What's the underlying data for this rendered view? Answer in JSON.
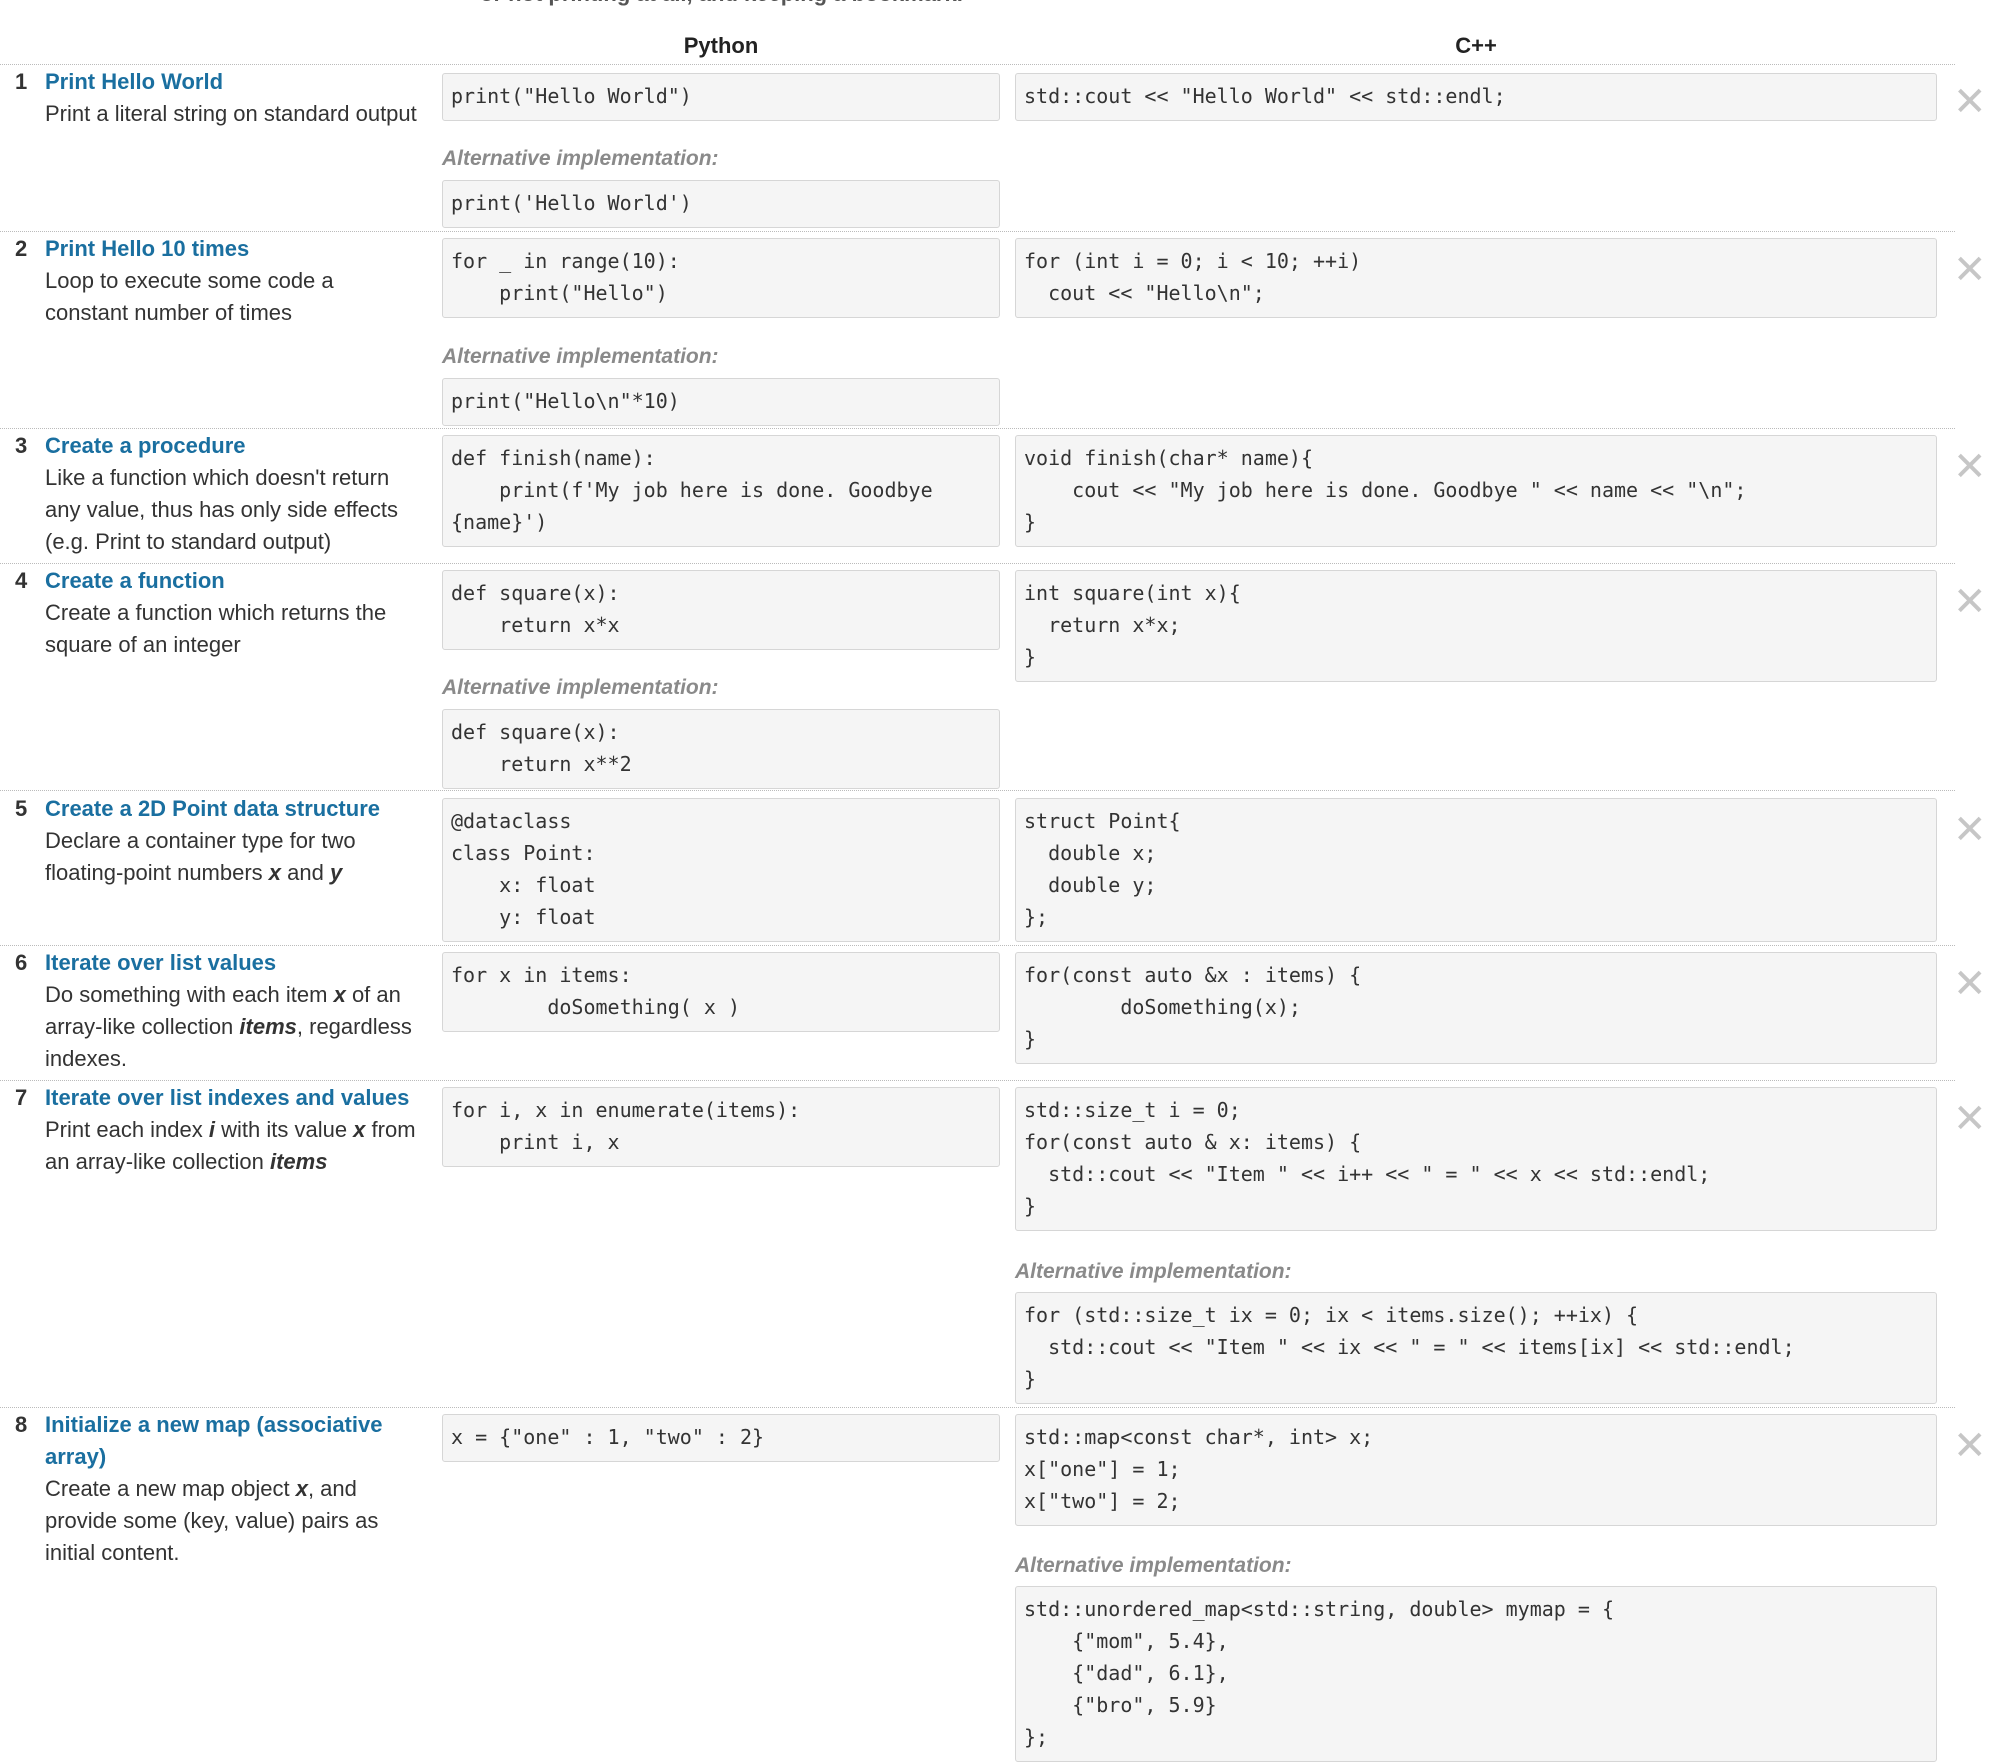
{
  "header": {
    "top_text": "or not printing at all, and keeping a bookmark."
  },
  "columns": {
    "python": "Python",
    "cpp": "C++"
  },
  "alt_label": "Alternative implementation:",
  "close_symbol": "✕",
  "rows": [
    {
      "num": "1",
      "title": "Print Hello World",
      "desc": "Print a literal string on standard output",
      "python": "print(\"Hello World\")",
      "python_alt": "print('Hello World')",
      "cpp": "std::cout << \"Hello World\" << std::endl;"
    },
    {
      "num": "2",
      "title": "Print Hello 10 times",
      "desc": "Loop to execute some code a constant number of times",
      "python": "for _ in range(10):\n    print(\"Hello\")",
      "python_alt": "print(\"Hello\\n\"*10)",
      "cpp": "for (int i = 0; i < 10; ++i)\n  cout << \"Hello\\n\";"
    },
    {
      "num": "3",
      "title": "Create a procedure",
      "desc": "Like a function which doesn't return any value, thus has only side effects (e.g. Print to standard output)",
      "python": "def finish(name):\n    print(f'My job here is done. Goodbye\n{name}')",
      "cpp": "void finish(char* name){\n    cout << \"My job here is done. Goodbye \" << name << \"\\n\";\n}"
    },
    {
      "num": "4",
      "title": "Create a function",
      "desc": "Create a function which returns the square of an integer",
      "python": "def square(x):\n    return x*x",
      "python_alt": "def square(x):\n    return x**2",
      "cpp": "int square(int x){\n  return x*x;\n}"
    },
    {
      "num": "5",
      "title": "Create a 2D Point data structure",
      "desc_parts": [
        "Declare a container type for two floating-point numbers ",
        "x",
        " and ",
        "y"
      ],
      "python": "@dataclass\nclass Point:\n    x: float\n    y: float",
      "cpp": "struct Point{\n  double x;\n  double y;\n};"
    },
    {
      "num": "6",
      "title": "Iterate over list values",
      "desc_parts": [
        "Do something with each item ",
        "x",
        " of an array-like collection ",
        "items",
        ", regardless indexes."
      ],
      "python": "for x in items:\n        doSomething( x )",
      "cpp": "for(const auto &x : items) {\n        doSomething(x);\n}"
    },
    {
      "num": "7",
      "title": "Iterate over list indexes and values",
      "desc_parts": [
        "Print each index ",
        "i",
        " with its value ",
        "x",
        " from an array-like collection ",
        "items"
      ],
      "python": "for i, x in enumerate(items):\n    print i, x",
      "cpp": "std::size_t i = 0;\nfor(const auto & x: items) {\n  std::cout << \"Item \" << i++ << \" = \" << x << std::endl;\n}",
      "cpp_alt": "for (std::size_t ix = 0; ix < items.size(); ++ix) {\n  std::cout << \"Item \" << ix << \" = \" << items[ix] << std::endl;\n}"
    },
    {
      "num": "8",
      "title": "Initialize a new map (associative array)",
      "desc_parts": [
        "Create a new map object ",
        "x",
        ", and provide some (key, value) pairs as initial content."
      ],
      "python": "x = {\"one\" : 1, \"two\" : 2}",
      "cpp": "std::map<const char*, int> x;\nx[\"one\"] = 1;\nx[\"two\"] = 2;",
      "cpp_alt": "std::unordered_map<std::string, double> mymap = {\n    {\"mom\", 5.4},\n    {\"dad\", 6.1},\n    {\"bro\", 5.9}\n};"
    }
  ]
}
